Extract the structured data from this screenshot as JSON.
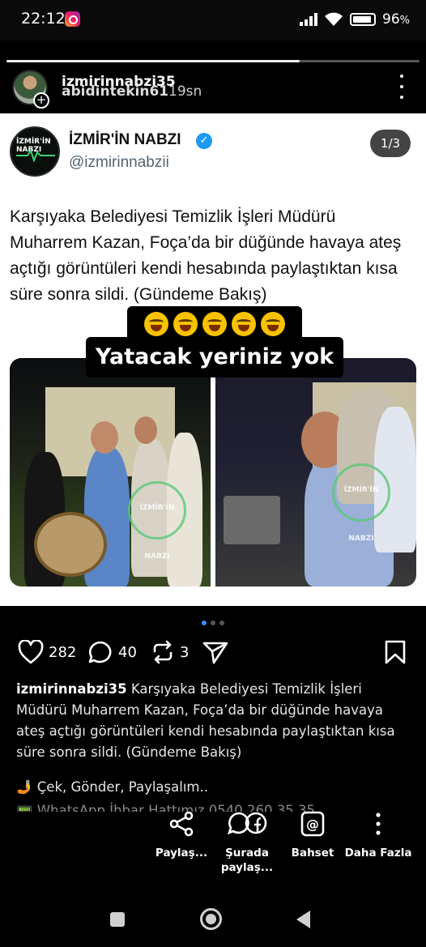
{
  "status_bar": {
    "time": "22:12",
    "battery": "96",
    "battery_suffix": "%",
    "notification_icon": "instagram-icon"
  },
  "story": {
    "progress": 0.71,
    "username_primary": "izmirinnabzi35",
    "username_overlap": "abidintekin61",
    "time_ago": "19sn",
    "more_icon": "vertical-dots-icon"
  },
  "tweet": {
    "display_name": "İZMİR'İN NABZI",
    "handle": "@izmirinnabzii",
    "logo_text": "İZMİR'İN NABZI",
    "page_indicator": "1/3",
    "text": "Karşıyaka Belediyesi Temizlik İşleri Müdürü Muharrem Kazan, Foça’da bir düğünde havaya ateş açtığı görüntüleri kendi hesabında paylaştıktan kısa süre sonra sildi. (Gündeme Bakış)",
    "emoji_overlay": "😂😂😂😂😂",
    "overlay_caption": "Yatacak yeriniz yok",
    "watermark_left": "İZMİR'İN NABZI",
    "watermark_right": "İZMİR'İN NABZI"
  },
  "carousel": {
    "count": 3,
    "active": 0,
    "accent": "#3b8cff"
  },
  "actions": {
    "likes": "282",
    "comments": "40",
    "reposts": "3",
    "icons": [
      "heart-icon",
      "comment-icon",
      "repost-icon",
      "send-icon",
      "bookmark-icon"
    ]
  },
  "caption": {
    "username": "izmirinnabzi35",
    "text": "Karşıyaka Belediyesi Temizlik İşleri Müdürü Muharrem Kazan, Foça’da bir düğünde havaya ateş açtığı görüntüleri kendi hesabında paylaştıktan kısa süre sonra sildi. (Gündeme Bakış)",
    "cta_line": "🤳 Çek, Gönder, Paylaşalım..",
    "cta_line2": "📟 WhatsApp İhbar Hattımız 0540 260 35 35"
  },
  "share_sheet": {
    "items": [
      {
        "label": "Paylaş...",
        "icon": "share-icon"
      },
      {
        "label": "Şurada paylaş...",
        "icon": "whatsapp-facebook-icon"
      },
      {
        "label": "Bahset",
        "icon": "mention-icon"
      },
      {
        "label": "Daha Fazla",
        "icon": "more-icon"
      }
    ]
  }
}
